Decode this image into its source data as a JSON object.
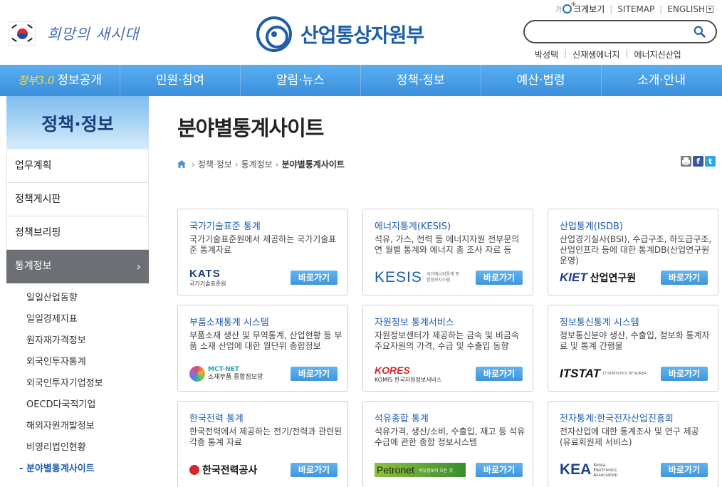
{
  "header": {
    "slogan": "희망의 새시대",
    "ministry_name": "산업통상자원부",
    "util": {
      "zoom_prefix": "가",
      "zoom_label": "크게보기",
      "sitemap": "SITEMAP",
      "english": "ENGLISH",
      "english_caret": "▾"
    },
    "search": {
      "value": "",
      "placeholder": ""
    },
    "quick_links": [
      "박성택",
      "신재생에너지",
      "에너지신산업"
    ]
  },
  "gnb": {
    "items": [
      {
        "prefix": "정부3.0",
        "label": "정보공개"
      },
      {
        "prefix": "",
        "label": "민원·참여"
      },
      {
        "prefix": "",
        "label": "알림·뉴스"
      },
      {
        "prefix": "",
        "label": "정책·정보"
      },
      {
        "prefix": "",
        "label": "예산·법령"
      },
      {
        "prefix": "",
        "label": "소개·안내"
      }
    ]
  },
  "sidebar": {
    "title": "정책·정보",
    "items": [
      "업무계획",
      "정책게시판",
      "정책브리핑",
      "통계정보"
    ],
    "active_chevron": "›",
    "sub_items": [
      "일일산업동향",
      "일일경제지표",
      "원자재가격정보",
      "외국인투자통계",
      "외국인투자기업정보",
      "OECD다국적기업",
      "해외자원개발정보",
      "비영리법인현황",
      "분야별통계사이트"
    ],
    "current_marker": "-"
  },
  "page": {
    "title": "분야별통계사이트",
    "breadcrumb": [
      "정책·정보",
      "통계정보",
      "분야별통계사이트"
    ],
    "breadcrumb_sep": "›"
  },
  "share": {
    "facebook": "f",
    "twitter": "t"
  },
  "cards": [
    {
      "title": "국가기술표준 통계",
      "desc": "국가기술표준원에서 제공하는 국가기술표준 통계자료",
      "button": "바로가기",
      "logo_main": "KATS",
      "logo_sub": "국가기술표준원"
    },
    {
      "title": "에너지통계(KESIS)",
      "desc": "석유, 가스, 전력 등 에너지자원 전부문의 연 월별 통계와 에너지 총 조사 자료 등",
      "button": "바로가기",
      "logo_main": "KESIS",
      "logo_sub": "국가에너지통계 종합정보시스템"
    },
    {
      "title": "산업통계(ISDB)",
      "desc": "산업경기실사(BSI), 수급구조, 하도급구조, 산업인프라 등에 대한 통계DB(산업연구원 운영)",
      "button": "바로가기",
      "logo_main": "KIET",
      "logo_sub": "산업연구원"
    },
    {
      "title": "부품소재통계 시스템",
      "desc": "부품소재 생산 및 무역통계, 산업현황 등 부품 소재 산업에 대한 월단위 종합정보",
      "button": "바로가기",
      "logo_main": "MCT-NET",
      "logo_sub": "소재부품 종합정보망"
    },
    {
      "title": "자원정보 통계서비스",
      "desc": "자원정보센터가 제공하는 금속 및 비금속 주요자원의 가격, 수급 및 수출입 동향",
      "button": "바로가기",
      "logo_main": "KORES",
      "logo_sub": "KOMIS 한국자원정보서비스"
    },
    {
      "title": "정보통신통계 시스템",
      "desc": "정보통신분야 생산, 수출입, 정보화 통계자료 및 통계 간행물",
      "button": "바로가기",
      "logo_main": "ITSTAT",
      "logo_sub": "IT STATISTICS OF KOREA"
    },
    {
      "title": "한국전력 통계",
      "desc": "한국전력에서 제공하는 전기/전력과 관련된 각종 통계 자료",
      "button": "바로가기",
      "logo_main": "한국전력공사",
      "logo_sub": ""
    },
    {
      "title": "석유종합 통계",
      "desc": "석유가격, 생산/소비, 수출입, 재고 등 석유수급에 관한 종합 정보시스템",
      "button": "바로가기",
      "logo_main": "Petronet",
      "logo_sub": "석유정보의 모든 것"
    },
    {
      "title": "전자통계:한국전자산업진흥회",
      "desc": "전자산업에 대한 통계조사 및 연구 제공 (유료회원제 서비스)",
      "button": "바로가기",
      "logo_main": "KEA",
      "logo_sub": "Korea Electronics Association"
    }
  ],
  "colors": {
    "gnb": "#4aa0e6",
    "link": "#1e5db1",
    "button": "#4fa3e3",
    "sidebar_active": "#6c6f74"
  }
}
